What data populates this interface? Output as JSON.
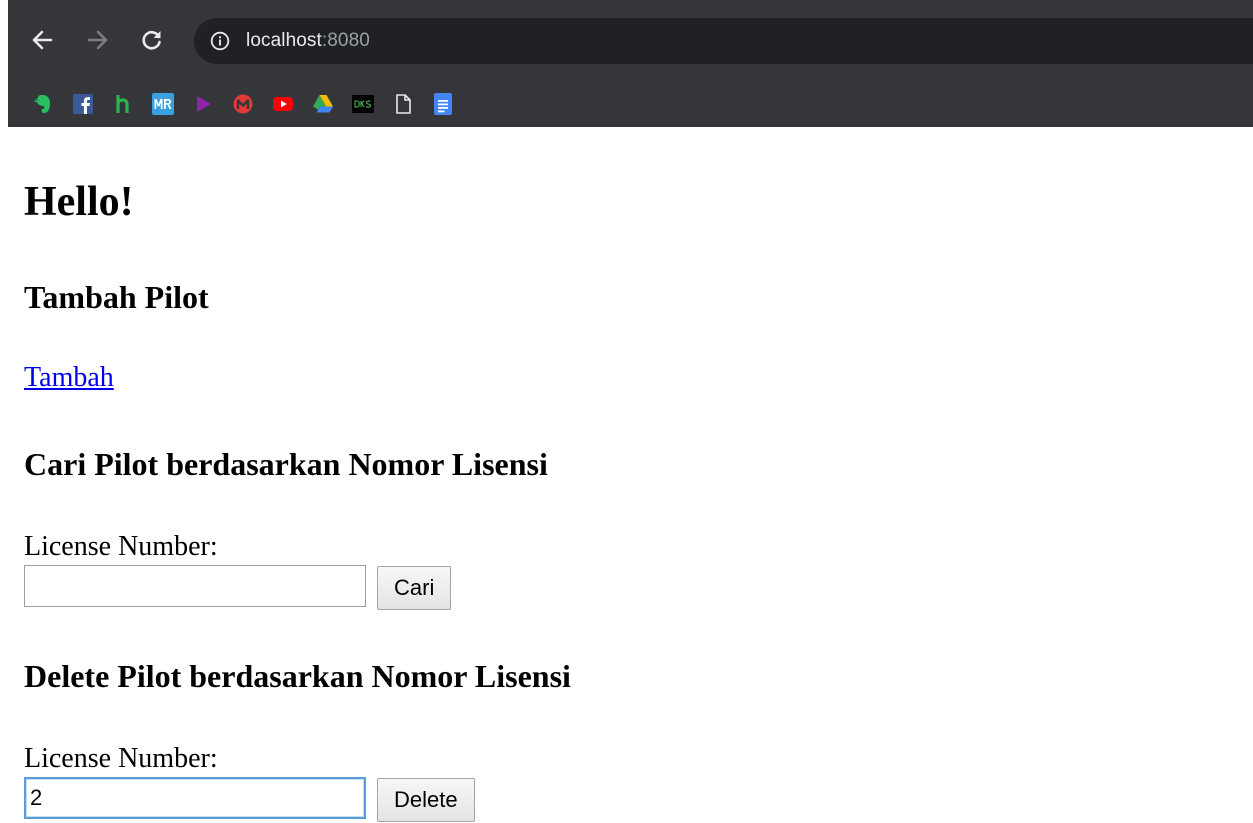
{
  "browser": {
    "address": {
      "host": "localhost",
      "port": ":8080"
    },
    "icons": {
      "back": "arrow-left-icon",
      "forward": "arrow-right-icon",
      "reload": "reload-icon",
      "info": "info-icon"
    },
    "bookmarks": [
      {
        "icon": "evernote-icon",
        "color": "#2dbe60"
      },
      {
        "icon": "facebook-icon",
        "color": "#3b5998"
      },
      {
        "icon": "h-icon",
        "color": "#2bb24c"
      },
      {
        "icon": "mr-icon",
        "color": "#3aa0e0"
      },
      {
        "icon": "play-icon",
        "color": "#8e24aa"
      },
      {
        "icon": "m-icon",
        "color": "#e53935"
      },
      {
        "icon": "youtube-icon",
        "color": "#ff0000"
      },
      {
        "icon": "google-drive-icon",
        "color": "#fbbc04"
      },
      {
        "icon": "dks-icon",
        "color": "#000000"
      },
      {
        "icon": "page-icon",
        "color": "#e8eaed"
      },
      {
        "icon": "google-docs-icon",
        "color": "#4285f4"
      }
    ]
  },
  "page": {
    "greeting": "Hello!",
    "add_section": {
      "title": "Tambah Pilot",
      "link": "Tambah"
    },
    "search_section": {
      "title": "Cari Pilot berdasarkan Nomor Lisensi",
      "label": "License Number:",
      "input_value": "",
      "button": "Cari"
    },
    "delete_section": {
      "title": "Delete Pilot berdasarkan Nomor Lisensi",
      "label": "License Number:",
      "input_value": "2",
      "button": "Delete"
    }
  }
}
